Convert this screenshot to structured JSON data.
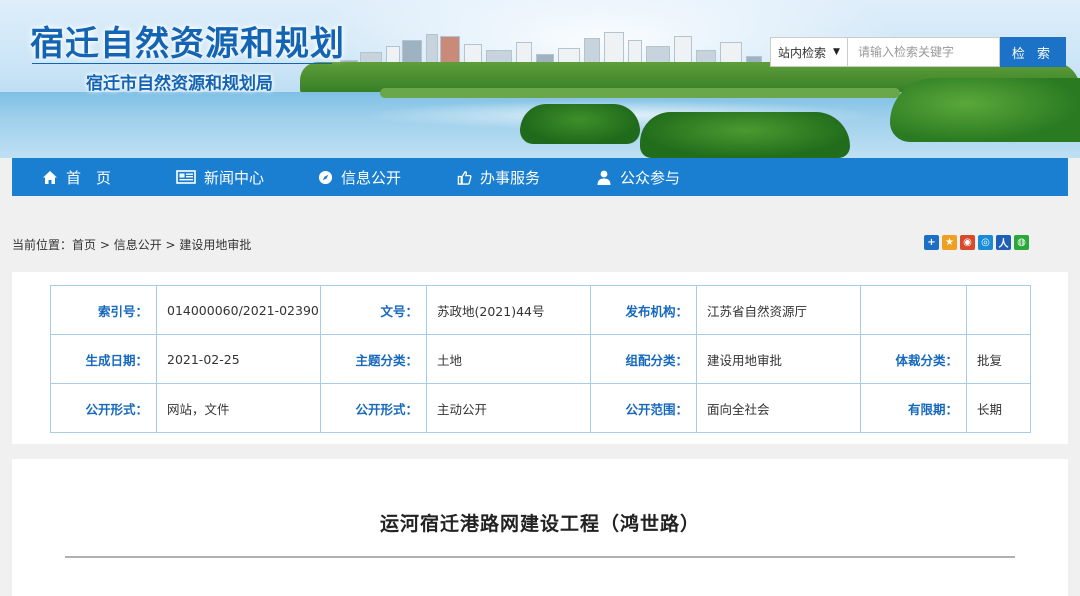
{
  "header": {
    "title": "宿迁自然资源和规划",
    "subtitle": "宿迁市自然资源和规划局"
  },
  "search": {
    "scope_label": "站内检索",
    "placeholder": "请输入检索关键字",
    "button_label": "检 索"
  },
  "nav": {
    "items": [
      {
        "label": "首　页",
        "icon": "home-icon"
      },
      {
        "label": "新闻中心",
        "icon": "newspaper-icon"
      },
      {
        "label": "信息公开",
        "icon": "compass-icon"
      },
      {
        "label": "办事服务",
        "icon": "thumbs-up-icon"
      },
      {
        "label": "公众参与",
        "icon": "user-icon"
      }
    ],
    "color": "#1a7fd0"
  },
  "breadcrumb": {
    "prefix": "当前位置：",
    "items": [
      "首页",
      "信息公开",
      "建设用地审批"
    ],
    "separator": " > "
  },
  "share_icons": [
    {
      "name": "share-plus-icon",
      "color": "#1b6fc4"
    },
    {
      "name": "share-qzone-icon",
      "color": "#f0a020"
    },
    {
      "name": "share-weibo-icon",
      "color": "#d84a2a"
    },
    {
      "name": "share-tencent-icon",
      "color": "#1a8bd8"
    },
    {
      "name": "share-renren-icon",
      "color": "#1f5fb8"
    },
    {
      "name": "share-wechat-icon",
      "color": "#2aa83a"
    }
  ],
  "meta": {
    "rows": [
      [
        {
          "k": "索引号：",
          "v": "014000060/2021-02390"
        },
        {
          "k": "文号：",
          "v": "苏政地(2021)44号"
        },
        {
          "k": "发布机构：",
          "v": "江苏省自然资源厅"
        },
        {
          "k": "",
          "v": ""
        }
      ],
      [
        {
          "k": "生成日期：",
          "v": "2021-02-25"
        },
        {
          "k": "主题分类：",
          "v": "土地"
        },
        {
          "k": "组配分类：",
          "v": "建设用地审批"
        },
        {
          "k": "体裁分类：",
          "v": "批复"
        }
      ],
      [
        {
          "k": "公开形式：",
          "v": "网站，文件"
        },
        {
          "k": "公开形式：",
          "v": "主动公开"
        },
        {
          "k": "公开范围：",
          "v": "面向全社会"
        },
        {
          "k": "有限期：",
          "v": "长期"
        }
      ]
    ]
  },
  "article": {
    "title": "运河宿迁港路网建设工程（鸿世路）"
  },
  "colors": {
    "brand": "#1464b4",
    "accent": "#1a7fd0",
    "label": "#1769bd",
    "border": "#a8cbe6"
  }
}
